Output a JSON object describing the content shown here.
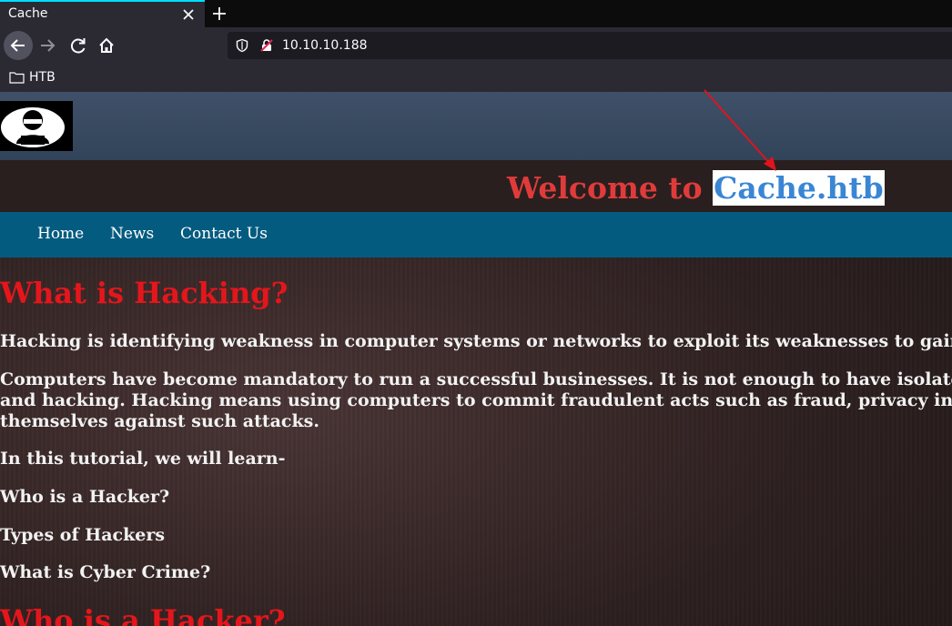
{
  "browser": {
    "tab": {
      "title": "Cache"
    },
    "address_bar": {
      "url": "10.10.10.188"
    },
    "bookmarks": [
      {
        "label": "HTB"
      }
    ]
  },
  "site": {
    "welcome_prefix": "Welcome to",
    "welcome_highlight": "Cache.htb",
    "menu": [
      {
        "label": "Home"
      },
      {
        "label": "News"
      },
      {
        "label": "Contact Us"
      }
    ]
  },
  "content": {
    "heading1": "What is Hacking?",
    "para1": "Hacking is identifying weakness in computer systems or networks to exploit its weaknesses to gain",
    "para2_line1": "Computers have become mandatory to run a successful businesses. It is not enough to have isolated",
    "para2_line2": "and hacking. Hacking means using computers to commit fraudulent acts such as fraud, privacy inva",
    "para2_line3": "themselves against such attacks.",
    "para3": "In this tutorial, we will learn-",
    "item1": "Who is a Hacker?",
    "item2": "Types of Hackers",
    "item3": "What is Cyber Crime?",
    "heading2": "Who is a Hacker?"
  },
  "colors": {
    "heading_red": "#e5161b",
    "welcome_red": "#e03b3b",
    "highlight_blue": "#3a86d4",
    "menu_blue": "#045b80",
    "annotation_arrow": "#e0141b"
  },
  "icons": [
    "close-icon",
    "plus-icon",
    "back-arrow-icon",
    "forward-arrow-icon",
    "reload-icon",
    "home-icon",
    "shield-icon",
    "insecure-lock-icon",
    "folder-icon",
    "hacker-logo"
  ]
}
